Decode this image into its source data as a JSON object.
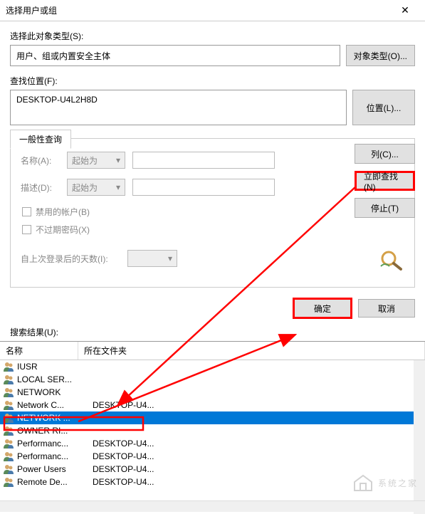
{
  "titlebar": {
    "title": "选择用户或组"
  },
  "object_type": {
    "label": "选择此对象类型(S):",
    "value": "用户、组或内置安全主体",
    "button": "对象类型(O)..."
  },
  "location": {
    "label": "查找位置(F):",
    "value": "DESKTOP-U4L2H8D",
    "button": "位置(L)..."
  },
  "tab": {
    "label": "一般性查询"
  },
  "query": {
    "name_label": "名称(A):",
    "name_combo": "起始为",
    "desc_label": "描述(D):",
    "desc_combo": "起始为",
    "disabled_accounts": "禁用的帐户(B)",
    "non_expiring": "不过期密码(X)",
    "days_since_logon": "自上次登录后的天数(I):"
  },
  "side_buttons": {
    "columns": "列(C)...",
    "find_now": "立即查找(N)",
    "stop": "停止(T)"
  },
  "dialog_buttons": {
    "ok": "确定",
    "cancel": "取消"
  },
  "results": {
    "label": "搜索结果(U):",
    "col_name": "名称",
    "col_folder": "所在文件夹",
    "rows": [
      {
        "name": "IUSR",
        "folder": ""
      },
      {
        "name": "LOCAL SER...",
        "folder": ""
      },
      {
        "name": "NETWORK",
        "folder": ""
      },
      {
        "name": "Network C...",
        "folder": "DESKTOP-U4..."
      },
      {
        "name": "NETWORK ...",
        "folder": "",
        "selected": true
      },
      {
        "name": "OWNER RI...",
        "folder": ""
      },
      {
        "name": "Performanc...",
        "folder": "DESKTOP-U4..."
      },
      {
        "name": "Performanc...",
        "folder": "DESKTOP-U4..."
      },
      {
        "name": "Power Users",
        "folder": "DESKTOP-U4..."
      },
      {
        "name": "Remote De...",
        "folder": "DESKTOP-U4..."
      }
    ]
  },
  "watermark": "系统之家"
}
